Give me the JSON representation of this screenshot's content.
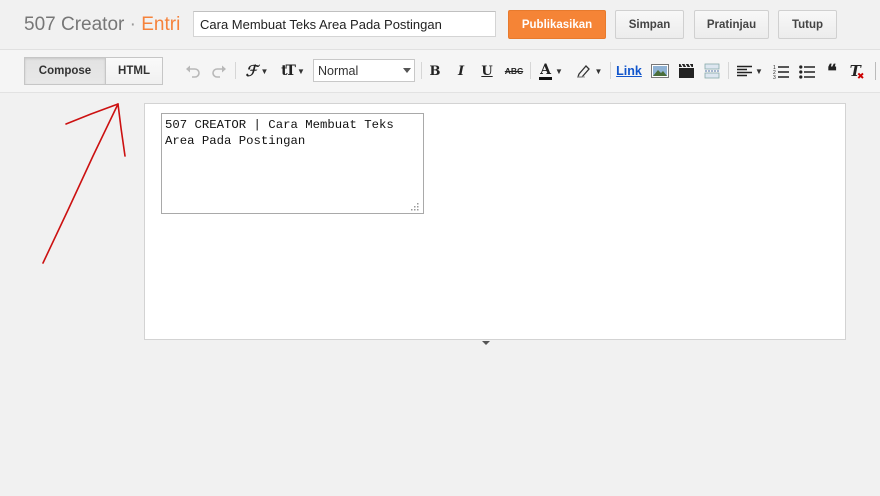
{
  "header": {
    "blog_name": "507 Creator",
    "separator": "·",
    "section": "Entri",
    "post_title": "Cara Membuat Teks Area Pada Postingan",
    "buttons": {
      "publish": "Publikasikan",
      "save": "Simpan",
      "preview": "Pratinjau",
      "close": "Tutup"
    },
    "publish_color": "#f58436"
  },
  "toolbar": {
    "modes": {
      "compose": "Compose",
      "html": "HTML",
      "active": "Compose"
    },
    "icons": [
      "undo-icon",
      "redo-icon",
      "font-family-icon",
      "font-size-icon",
      "bold-icon",
      "italic-icon",
      "underline-icon",
      "strikethrough-icon",
      "text-color-icon",
      "highlight-icon",
      "image-icon",
      "video-icon",
      "jump-break-icon",
      "align-icon",
      "numbered-list-icon",
      "bulleted-list-icon",
      "quote-icon",
      "remove-format-icon"
    ],
    "format_value": "Normal",
    "bold": "B",
    "italic": "I",
    "underline": "U",
    "strike": "ABC",
    "text_color": "A",
    "link": "Link",
    "quote": "❝",
    "clear_format": "T"
  },
  "editor": {
    "textarea_content": "507 CREATOR | Cara Membuat Teks Area Pada Postingan"
  },
  "annotation": {
    "arrow_color": "#cc1111"
  }
}
